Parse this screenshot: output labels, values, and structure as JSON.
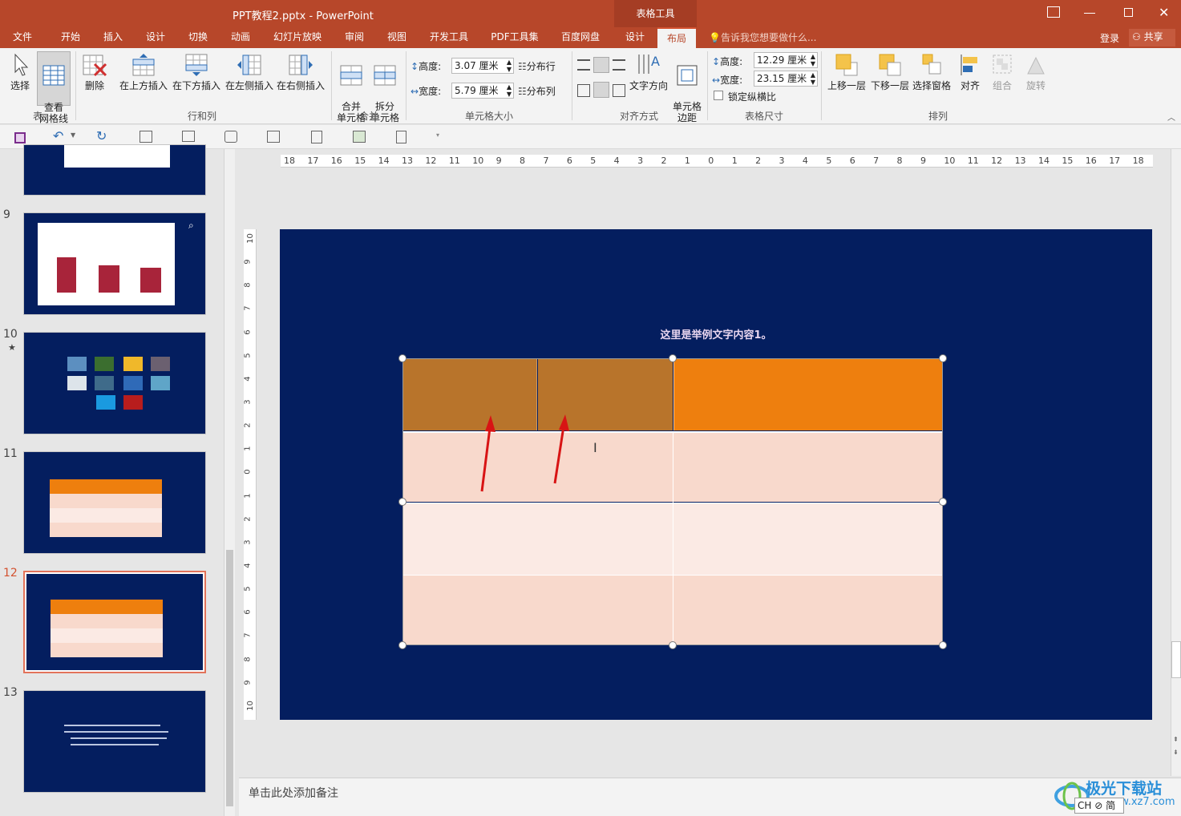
{
  "window": {
    "title": "PPT教程2.pptx - PowerPoint",
    "context_tab": "表格工具"
  },
  "tabs": [
    "文件",
    "开始",
    "插入",
    "设计",
    "切换",
    "动画",
    "幻灯片放映",
    "审阅",
    "视图",
    "开发工具",
    "PDF工具集",
    "百度网盘",
    "设计",
    "布局"
  ],
  "active_tab": "布局",
  "tell_me": "告诉我您想要做什么...",
  "account": {
    "login": "登录",
    "share": "共享"
  },
  "ribbon": {
    "select": "选择",
    "gridlines": "查看\n网格线",
    "delete": "删除",
    "insert_above": "在上方插入",
    "insert_below": "在下方插入",
    "insert_left": "在左侧插入",
    "insert_right": "在右侧插入",
    "merge": "合并\n单元格",
    "split": "拆分\n单元格",
    "cell_height_label": "高度:",
    "cell_height": "3.07 厘米",
    "cell_width_label": "宽度:",
    "cell_width": "5.79 厘米",
    "dist_rows": "分布行",
    "dist_cols": "分布列",
    "text_direction": "文字方向",
    "cell_margins": "单元格\n边距",
    "table_height_label": "高度:",
    "table_height": "12.29 厘米",
    "table_width_label": "宽度:",
    "table_width": "23.15 厘米",
    "lock_ratio": "锁定纵横比",
    "bring_forward": "上移一层",
    "send_backward": "下移一层",
    "selection_pane": "选择窗格",
    "align": "对齐",
    "group": "组合",
    "rotate": "旋转",
    "groups": {
      "table": "表",
      "rows_cols": "行和列",
      "merge": "合并",
      "cell_size": "单元格大小",
      "alignment": "对齐方式",
      "table_size": "表格尺寸",
      "arrange": "排列"
    }
  },
  "ruler": {
    "h": [
      "18",
      "17",
      "16",
      "15",
      "14",
      "13",
      "12",
      "11",
      "10",
      "9",
      "8",
      "7",
      "6",
      "5",
      "4",
      "3",
      "2",
      "1",
      "0",
      "1",
      "2",
      "3",
      "4",
      "5",
      "6",
      "7",
      "8",
      "9",
      "10",
      "11",
      "12",
      "13",
      "14",
      "15",
      "16",
      "17",
      "18"
    ],
    "v": [
      "10",
      "9",
      "8",
      "7",
      "6",
      "5",
      "4",
      "3",
      "2",
      "1",
      "0",
      "1",
      "2",
      "3",
      "4",
      "5",
      "6",
      "7",
      "8",
      "9",
      "10"
    ]
  },
  "thumbnails": [
    {
      "num": "",
      "star": ""
    },
    {
      "num": "9",
      "star": ""
    },
    {
      "num": "10",
      "star": "★"
    },
    {
      "num": "11",
      "star": ""
    },
    {
      "num": "12",
      "star": ""
    },
    {
      "num": "13",
      "star": ""
    }
  ],
  "slide": {
    "caption": "这里是举例文字内容1。"
  },
  "notes": {
    "placeholder": "单击此处添加备注"
  },
  "watermark": {
    "text": "极光下载站",
    "url": "www.xz7.com"
  },
  "ime": "CH ⊘ 简",
  "colors": {
    "ribbon": "#b7472a",
    "slide_bg": "#041e5f",
    "header_cell": "#ee7f0e",
    "header_cell_split": "#b8742b",
    "row_a": "#f8d9cc",
    "row_b": "#fbeae4",
    "arrow": "#e01010"
  }
}
